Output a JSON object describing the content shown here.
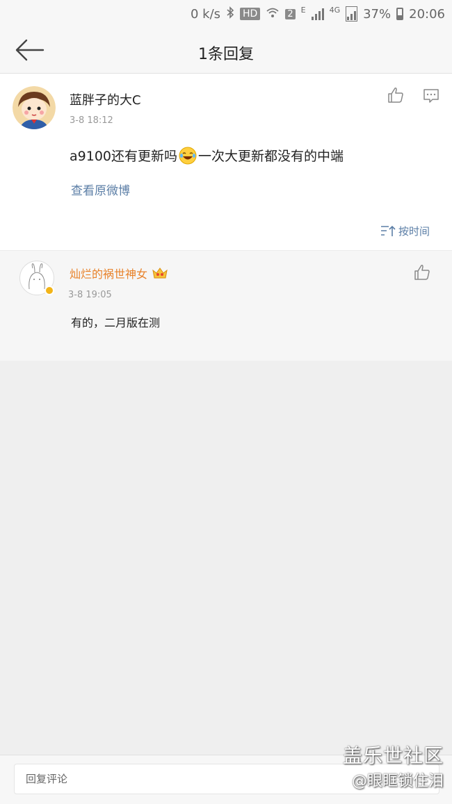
{
  "status_bar": {
    "net_speed": "0 k/s",
    "hd_badge": "HD",
    "sim_slot": "2",
    "network_e": "E",
    "network_4g": "4G",
    "battery": "37%",
    "time": "20:06",
    "icons": [
      "bluetooth-icon",
      "wifi-icon",
      "signal-icon",
      "battery-icon"
    ]
  },
  "header": {
    "title": "1条回复"
  },
  "main_comment": {
    "author": "蓝胖子的大C",
    "timestamp": "3-8 18:12",
    "text_before_emoji": "a9100还有更新吗",
    "text_after_emoji": "一次大更新都没有的中端",
    "view_original": "查看原微博",
    "sort_label": "按时间"
  },
  "reply": {
    "author": "灿烂的祸世神女",
    "timestamp": "3-8 19:05",
    "text": "有的，二月版在测"
  },
  "bottom_bar": {
    "input_placeholder": "回复评论"
  },
  "watermark": {
    "title": "盖乐世社区",
    "user": "@眼眶锁住泪"
  },
  "colors": {
    "link": "#5b7ea6",
    "reply_author": "#e8822a",
    "background": "#efefef"
  }
}
